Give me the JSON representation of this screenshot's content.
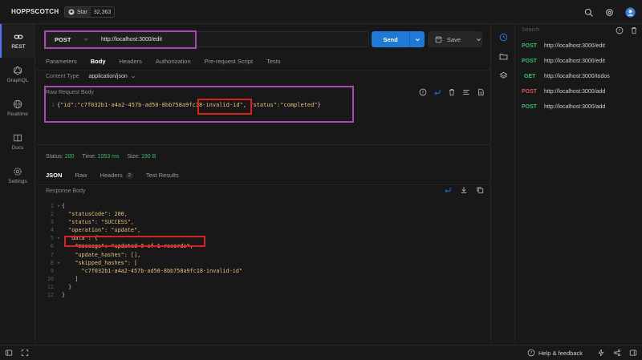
{
  "app": {
    "brand": "HOPPSCOTCH",
    "github_star_label": "Star",
    "github_star_count": "32,363"
  },
  "nav": [
    {
      "label": "REST",
      "icon": "link-icon",
      "active": true
    },
    {
      "label": "GraphQL",
      "icon": "graphql-icon"
    },
    {
      "label": "Realtime",
      "icon": "globe-icon"
    },
    {
      "label": "Docs",
      "icon": "book-icon"
    },
    {
      "label": "Settings",
      "icon": "gear-icon"
    }
  ],
  "request": {
    "method": "POST",
    "url": "http://localhost:3000/edit",
    "send_label": "Send",
    "save_label": "Save",
    "tabs": [
      "Parameters",
      "Body",
      "Headers",
      "Authorization",
      "Pre-request Script",
      "Tests"
    ],
    "active_tab": "Body",
    "content_type_label": "Content Type",
    "content_type_value": "application/json",
    "raw_body_label": "Raw Request Body",
    "raw_body_line_no": "1",
    "raw_body_parts": {
      "p1": "{",
      "id_key": "\"id\"",
      "colon": ":",
      "id_val_a": "\"c7f032b1-a4a2-457b-ad50-8bb758a9fc1",
      "id_val_b": "8-invalid-id\"",
      "comma": ", ",
      "status_key": "\"status\"",
      "colon2": ":",
      "status_val": "\"completed\"",
      "p2": "}"
    }
  },
  "response": {
    "status_label": "Status:",
    "status_value": "200",
    "time_label": "Time:",
    "time_value": "1053 ms",
    "size_label": "Size:",
    "size_value": "190 B",
    "tabs": [
      "JSON",
      "Raw",
      "Headers",
      "Test Results"
    ],
    "headers_count": "2",
    "body_label": "Response Body",
    "lines": [
      {
        "n": "1",
        "f": "▾",
        "text": "{"
      },
      {
        "n": "2",
        "f": "",
        "text": "  \"statusCode\": 200,"
      },
      {
        "n": "3",
        "f": "",
        "text": "  \"status\": \"SUCCESS\","
      },
      {
        "n": "4",
        "f": "",
        "text": "  \"operation\": \"update\","
      },
      {
        "n": "5",
        "f": "▾",
        "text": "  \"data\": {"
      },
      {
        "n": "6",
        "f": "",
        "text": "    \"message\": \"updated 0 of 1 records\","
      },
      {
        "n": "7",
        "f": "",
        "text": "    \"update_hashes\": [],"
      },
      {
        "n": "8",
        "f": "▾",
        "text": "    \"skipped_hashes\": ["
      },
      {
        "n": "9",
        "f": "",
        "text": "      \"c7f032b1-a4a2-457b-ad50-8bb758a9fc18-invalid-id\""
      },
      {
        "n": "10",
        "f": "",
        "text": "    ]"
      },
      {
        "n": "11",
        "f": "",
        "text": "  }"
      },
      {
        "n": "12",
        "f": "",
        "text": "}"
      }
    ]
  },
  "history": {
    "search_placeholder": "Search",
    "items": [
      {
        "method": "POST",
        "url": "http://localhost:3000/edit",
        "color": "#2fbf71"
      },
      {
        "method": "POST",
        "url": "http://localhost:3000/edit",
        "color": "#2fbf71"
      },
      {
        "method": "GET",
        "url": "http://localhost:3000/todos",
        "color": "#2fbf71"
      },
      {
        "method": "POST",
        "url": "http://localhost:3000/add",
        "color": "#e05252"
      },
      {
        "method": "POST",
        "url": "http://localhost:3000/add",
        "color": "#2fbf71"
      }
    ]
  },
  "footer": {
    "help_label": "Help & feedback"
  },
  "colors": {
    "accent": "#1d7ad9",
    "highlight_purple": "#a64ab0",
    "highlight_red": "#e01e1e",
    "success": "#2fbf71"
  }
}
